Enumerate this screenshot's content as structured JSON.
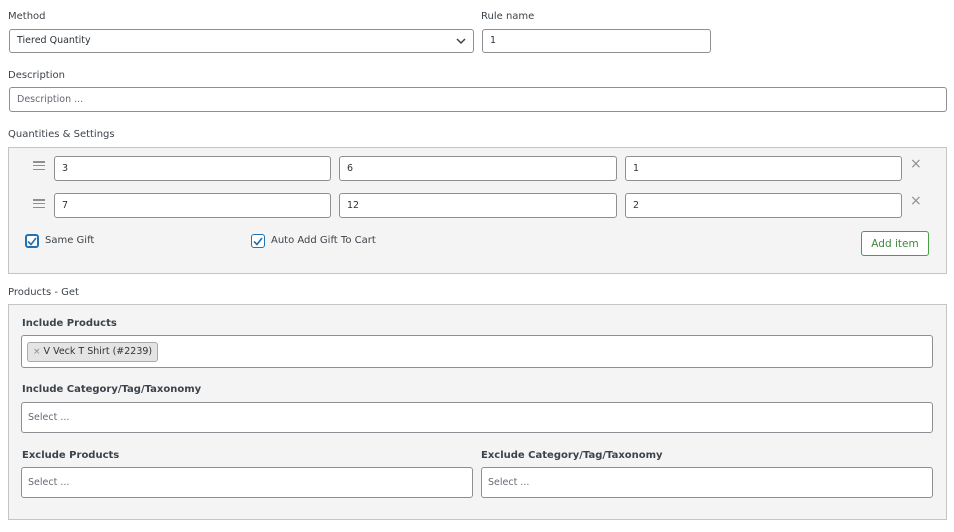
{
  "rule": {
    "method_label": "Method",
    "method_value": "Tiered Quantity",
    "rule_name_label": "Rule name",
    "rule_name_value": "1",
    "description_label": "Description",
    "description_placeholder": "Description ..."
  },
  "quantities": {
    "section_label": "Quantities & Settings",
    "rows": [
      {
        "from": "3",
        "to": "6",
        "gift_qty": "1"
      },
      {
        "from": "7",
        "to": "12",
        "gift_qty": "2"
      }
    ],
    "remove_glyph": "×",
    "same_gift_label": "Same Gift",
    "same_gift_checked": true,
    "auto_add_label": "Auto Add Gift To Cart",
    "auto_add_checked": true,
    "add_item_label": "Add item"
  },
  "products_get": {
    "section_label": "Products - Get",
    "include_products_label": "Include Products",
    "include_products_tags": [
      {
        "remove": "×",
        "text": "V Veck T Shirt (#2239)"
      }
    ],
    "include_category_label": "Include Category/Tag/Taxonomy",
    "include_category_placeholder": "Select ...",
    "exclude_products_label": "Exclude Products",
    "exclude_products_placeholder": "Select ...",
    "exclude_category_label": "Exclude Category/Tag/Taxonomy",
    "exclude_category_placeholder": "Select ..."
  },
  "icons": {
    "drag": "drag-handle-icon",
    "remove": "close-icon",
    "dropdown": "chevron-down-icon",
    "check": "checkmark-icon"
  },
  "colors": {
    "accent_blue": "#2271b1",
    "add_button_green": "#46a046",
    "panel_bg": "#f4f4f4",
    "border": "#8c8f94"
  }
}
